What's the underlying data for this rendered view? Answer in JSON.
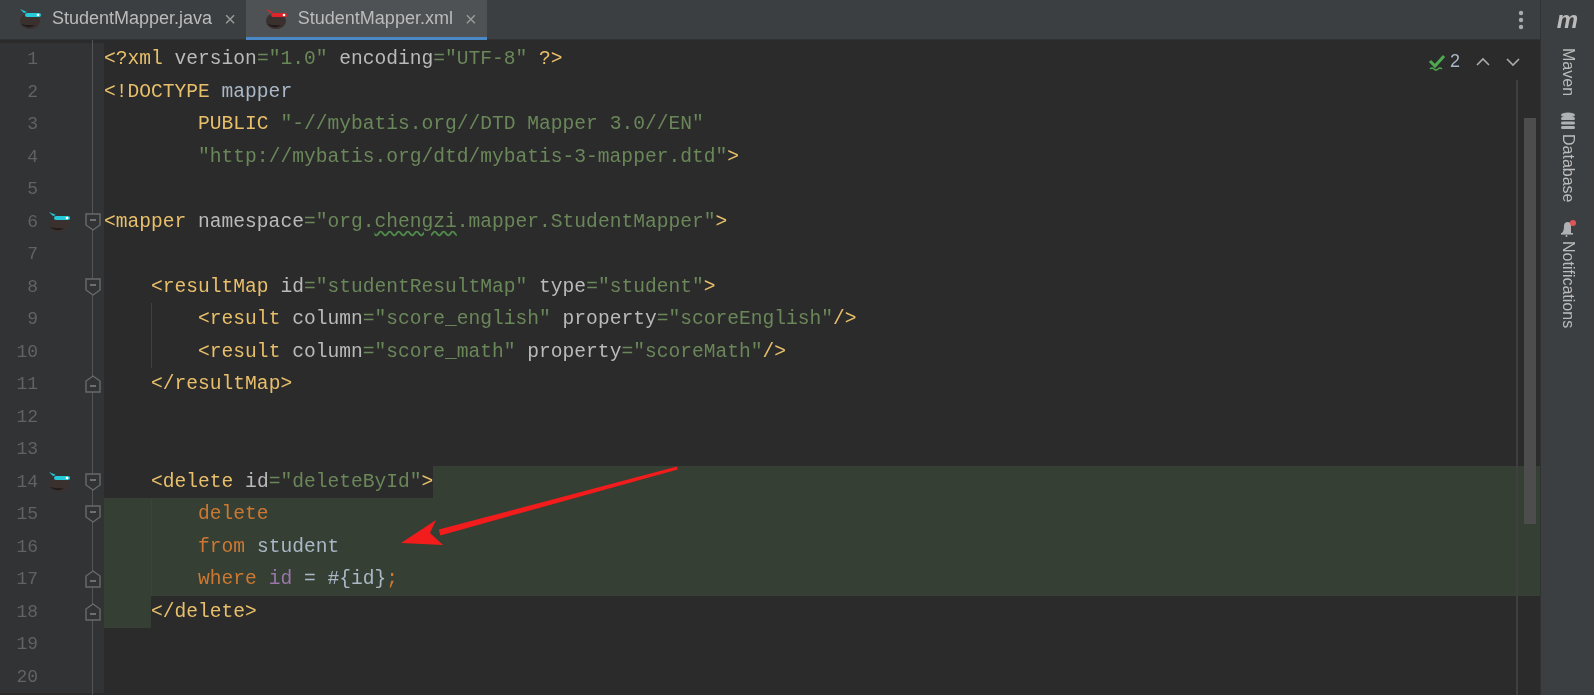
{
  "tabs": [
    {
      "label": "StudentMapper.java",
      "close": "×",
      "color": "#25c9d9",
      "selected": false
    },
    {
      "label": "StudentMapper.xml",
      "close": "×",
      "color": "#e0242c",
      "selected": true
    }
  ],
  "inspection": {
    "count": "2"
  },
  "editor": {
    "lines": [
      {
        "n": "1",
        "kind": "plain",
        "gutter_icon": false,
        "guide": false,
        "tokens": [
          {
            "t": "<?xml",
            "kind": "tag"
          },
          {
            "t": " version",
            "kind": "attr"
          },
          {
            "t": "=\"1.0\"",
            "kind": "value"
          },
          {
            "t": " encoding",
            "kind": "attr"
          },
          {
            "t": "=\"UTF-8\"",
            "kind": "value"
          },
          {
            "t": " ?>",
            "kind": "tag"
          }
        ]
      },
      {
        "n": "2",
        "kind": "plain",
        "gutter_icon": false,
        "guide": false,
        "tokens": [
          {
            "t": "<!DOCTYPE",
            "kind": "tag"
          },
          {
            "t": " mapper",
            "kind": "text"
          }
        ]
      },
      {
        "n": "3",
        "kind": "plain",
        "gutter_icon": false,
        "guide": false,
        "tokens": [
          {
            "t": "        PUBLIC",
            "kind": "tag"
          },
          {
            "t": " \"-//mybatis.org//DTD Mapper 3.0//EN\"",
            "kind": "value"
          }
        ]
      },
      {
        "n": "4",
        "kind": "plain",
        "gutter_icon": false,
        "guide": false,
        "tokens": [
          {
            "t": "        \"http://mybatis.org/dtd/mybatis-3-mapper.dtd\"",
            "kind": "value"
          },
          {
            "t": ">",
            "kind": "tag"
          }
        ]
      },
      {
        "n": "5",
        "kind": "plain",
        "gutter_icon": false,
        "guide": false
      },
      {
        "n": "6",
        "kind": "plain",
        "fold": {
          "kind": "start"
        },
        "gutter_icon": true,
        "guide": false,
        "tokens": [
          {
            "t": "<mapper",
            "kind": "tag"
          },
          {
            "t": " namespace",
            "kind": "attr"
          },
          {
            "t": "=\"org.",
            "kind": "value"
          },
          {
            "t": "chengzi",
            "kind": "typo"
          },
          {
            "t": ".mapper.StudentMapper\"",
            "kind": "value"
          },
          {
            "t": ">",
            "kind": "tag"
          }
        ]
      },
      {
        "n": "7",
        "kind": "plain",
        "gutter_icon": false,
        "guide": false
      },
      {
        "n": "8",
        "kind": "plain",
        "fold": {
          "kind": "start"
        },
        "gutter_icon": false,
        "guide": false,
        "tokens": [
          {
            "t": "    <resultMap",
            "kind": "tag"
          },
          {
            "t": " id",
            "kind": "attr"
          },
          {
            "t": "=\"studentResultMap\"",
            "kind": "value"
          },
          {
            "t": " type",
            "kind": "attr"
          },
          {
            "t": "=\"student\"",
            "kind": "value"
          },
          {
            "t": ">",
            "kind": "tag"
          }
        ]
      },
      {
        "n": "9",
        "kind": "plain",
        "gutter_icon": false,
        "guide": true,
        "tokens": [
          {
            "t": "        <result",
            "kind": "tag"
          },
          {
            "t": " column",
            "kind": "attr"
          },
          {
            "t": "=\"score_english\"",
            "kind": "value"
          },
          {
            "t": " property",
            "kind": "attr"
          },
          {
            "t": "=\"scoreEnglish\"",
            "kind": "value"
          },
          {
            "t": "/>",
            "kind": "tag"
          }
        ]
      },
      {
        "n": "10",
        "kind": "plain",
        "gutter_icon": false,
        "guide": true,
        "tokens": [
          {
            "t": "        <result",
            "kind": "tag"
          },
          {
            "t": " column",
            "kind": "attr"
          },
          {
            "t": "=\"score_math\"",
            "kind": "value"
          },
          {
            "t": " property",
            "kind": "attr"
          },
          {
            "t": "=\"scoreMath\"",
            "kind": "value"
          },
          {
            "t": "/>",
            "kind": "tag"
          }
        ]
      },
      {
        "n": "11",
        "kind": "plain",
        "fold": {
          "kind": "end"
        },
        "gutter_icon": false,
        "guide": false,
        "tokens": [
          {
            "t": "    </resultMap>",
            "kind": "tag"
          }
        ]
      },
      {
        "n": "12",
        "kind": "plain",
        "gutter_icon": false,
        "guide": false
      },
      {
        "n": "13",
        "kind": "plain",
        "gutter_icon": false,
        "guide": false
      },
      {
        "n": "14",
        "kind": "tailband",
        "fold": {
          "kind": "start"
        },
        "gutter_icon": true,
        "guide": false,
        "tokens": [
          {
            "t": "    <delete",
            "kind": "tag"
          },
          {
            "t": " id",
            "kind": "attr"
          },
          {
            "t": "=\"deleteById\"",
            "kind": "value"
          },
          {
            "t": ">",
            "kind": "tag"
          }
        ]
      },
      {
        "n": "15",
        "kind": "fullband",
        "fold": {
          "kind": "start"
        },
        "gutter_icon": false,
        "guide": true,
        "tokens": [
          {
            "t": "        delete",
            "kind": "keyword"
          }
        ]
      },
      {
        "n": "16",
        "kind": "fullband",
        "gutter_icon": false,
        "guide": true,
        "tokens": [
          {
            "t": "        from",
            "kind": "keyword"
          },
          {
            "t": " student",
            "kind": "text"
          }
        ]
      },
      {
        "n": "17",
        "kind": "fullband",
        "fold": {
          "kind": "end"
        },
        "gutter_icon": false,
        "guide": true,
        "tokens": [
          {
            "t": "        where",
            "kind": "keyword"
          },
          {
            "t": " id",
            "kind": "column"
          },
          {
            "t": " = #{id}",
            "kind": "text"
          },
          {
            "t": ";",
            "kind": "keyword"
          }
        ]
      },
      {
        "n": "18",
        "kind": "indentband",
        "fold": {
          "kind": "end"
        },
        "gutter_icon": false,
        "guide": false,
        "tokens": [
          {
            "t": "    </delete>",
            "kind": "tag"
          }
        ]
      },
      {
        "n": "19",
        "kind": "plain",
        "gutter_icon": false,
        "guide": false
      },
      {
        "n": "20",
        "kind": "plain",
        "gutter_icon": false,
        "guide": false
      }
    ]
  },
  "toolbar": {
    "logo": "m",
    "items": [
      {
        "label": "Maven",
        "kind": "plain"
      },
      {
        "label": "Database",
        "kind": "database"
      },
      {
        "label": "Notifications",
        "kind": "bell"
      }
    ]
  }
}
